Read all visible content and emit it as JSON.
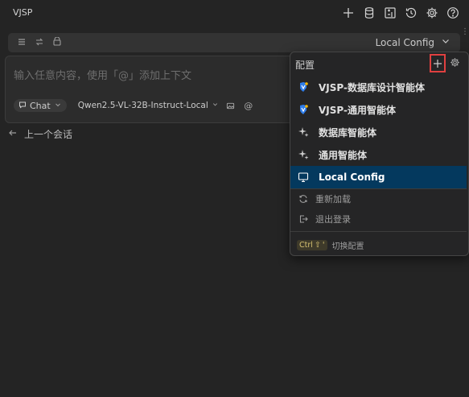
{
  "app": {
    "title": "VJSP",
    "top_icons": [
      "plus-icon",
      "database-icon",
      "diff-icon",
      "history-icon",
      "gear-icon",
      "help-icon"
    ]
  },
  "config_bar": {
    "icons": [
      "list-icon",
      "swap-icon",
      "package-icon"
    ],
    "selected_config": "Local Config"
  },
  "input": {
    "placeholder": "输入任意内容，使用「@」添加上下文",
    "mode_label": "Chat",
    "model": "Qwen2.5-VL-32B-Instruct-Local"
  },
  "prev_session": {
    "label": "上一个会话"
  },
  "dropdown": {
    "title": "配置",
    "items": [
      {
        "label": "VJSP-数据库设计智能体",
        "icon": "vjsp-logo-icon",
        "selected": false
      },
      {
        "label": "VJSP-通用智能体",
        "icon": "vjsp-logo-icon",
        "selected": false
      },
      {
        "label": "数据库智能体",
        "icon": "sparkle-icon",
        "selected": false
      },
      {
        "label": "通用智能体",
        "icon": "sparkle-icon",
        "selected": false
      },
      {
        "label": "Local Config",
        "icon": "monitor-icon",
        "selected": true
      }
    ],
    "actions": [
      {
        "label": "重新加载",
        "icon": "reload-icon"
      },
      {
        "label": "退出登录",
        "icon": "logout-icon"
      }
    ],
    "footer": {
      "key": "Ctrl",
      "key_symbol": "⇧",
      "key_tail": "'",
      "label": "切换配置"
    }
  },
  "colors": {
    "background": "#242424",
    "selected_item": "#04395e",
    "highlight_border": "#e04040",
    "vjsp_blue": "#2f7dea",
    "vjsp_yellow": "#f5b400"
  }
}
